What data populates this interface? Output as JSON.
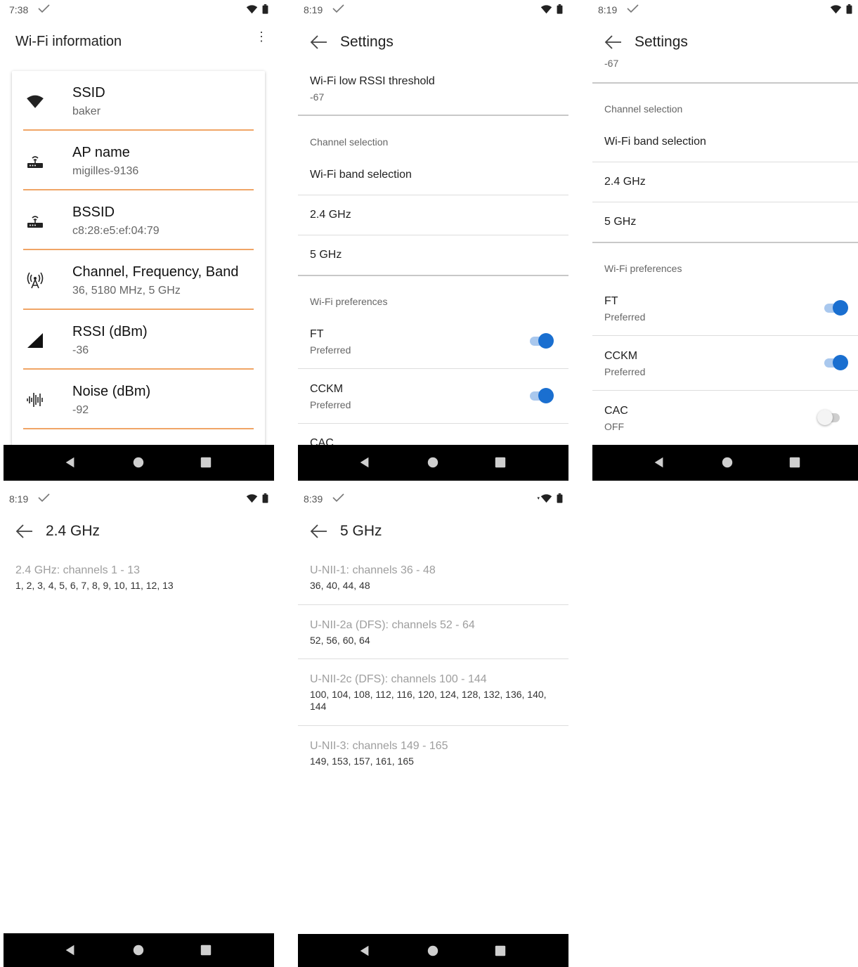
{
  "screen1": {
    "time": "7:38",
    "title": "Wi-Fi information",
    "items": [
      {
        "label": "SSID",
        "value": "baker",
        "icon": "wifi-icon"
      },
      {
        "label": "AP name",
        "value": "migilles-9136",
        "icon": "router-icon"
      },
      {
        "label": "BSSID",
        "value": "c8:28:e5:ef:04:79",
        "icon": "router-icon"
      },
      {
        "label": "Channel, Frequency, Band",
        "value": "36, 5180 MHz, 5 GHz",
        "icon": "antenna-icon"
      },
      {
        "label": "RSSI (dBm)",
        "value": "-36",
        "icon": "signal-icon"
      },
      {
        "label": "Noise (dBm)",
        "value": "-92",
        "icon": "waveform-icon"
      }
    ]
  },
  "screen2": {
    "time": "8:19",
    "title": "Settings",
    "rssi_title": "Wi-Fi low RSSI threshold",
    "rssi_value": "-67",
    "channel_section": "Channel selection",
    "band_selection": "Wi-Fi band selection",
    "band_24": "2.4 GHz",
    "band_5": "5 GHz",
    "prefs_section": "Wi-Fi preferences",
    "ft_title": "FT",
    "ft_sub": "Preferred",
    "ft_on": true,
    "cckm_title": "CCKM",
    "cckm_sub": "Preferred",
    "cckm_on": true,
    "cac_partial": "CAC"
  },
  "screen3": {
    "time": "8:19",
    "title": "Settings",
    "rssi_value_partial": "-67",
    "channel_section": "Channel selection",
    "band_selection": "Wi-Fi band selection",
    "band_24": "2.4 GHz",
    "band_5": "5 GHz",
    "prefs_section": "Wi-Fi preferences",
    "ft_title": "FT",
    "ft_sub": "Preferred",
    "ft_on": true,
    "cckm_title": "CCKM",
    "cckm_sub": "Preferred",
    "cckm_on": true,
    "cac_title": "CAC",
    "cac_sub": "OFF",
    "cac_on": false
  },
  "screen4": {
    "time": "8:19",
    "title": "2.4 GHz",
    "groups": [
      {
        "title": "2.4 GHz: channels 1 - 13",
        "channels": "1, 2, 3, 4, 5, 6, 7, 8, 9, 10, 11, 12, 13"
      }
    ]
  },
  "screen5": {
    "time": "8:39",
    "title": "5 GHz",
    "groups": [
      {
        "title": "U-NII-1: channels 36 - 48",
        "channels": "36, 40, 44, 48"
      },
      {
        "title": "U-NII-2a (DFS): channels 52 - 64",
        "channels": "52, 56, 60, 64"
      },
      {
        "title": "U-NII-2c (DFS): channels 100 - 144",
        "channels": "100, 104, 108, 112, 116, 120, 124, 128, 132, 136, 140, 144"
      },
      {
        "title": "U-NII-3: channels 149 - 165",
        "channels": "149, 153, 157, 161, 165"
      }
    ]
  },
  "colors": {
    "accent": "#1a6fd0",
    "divider_orange": "#f0a566",
    "navbar": "#000000"
  }
}
